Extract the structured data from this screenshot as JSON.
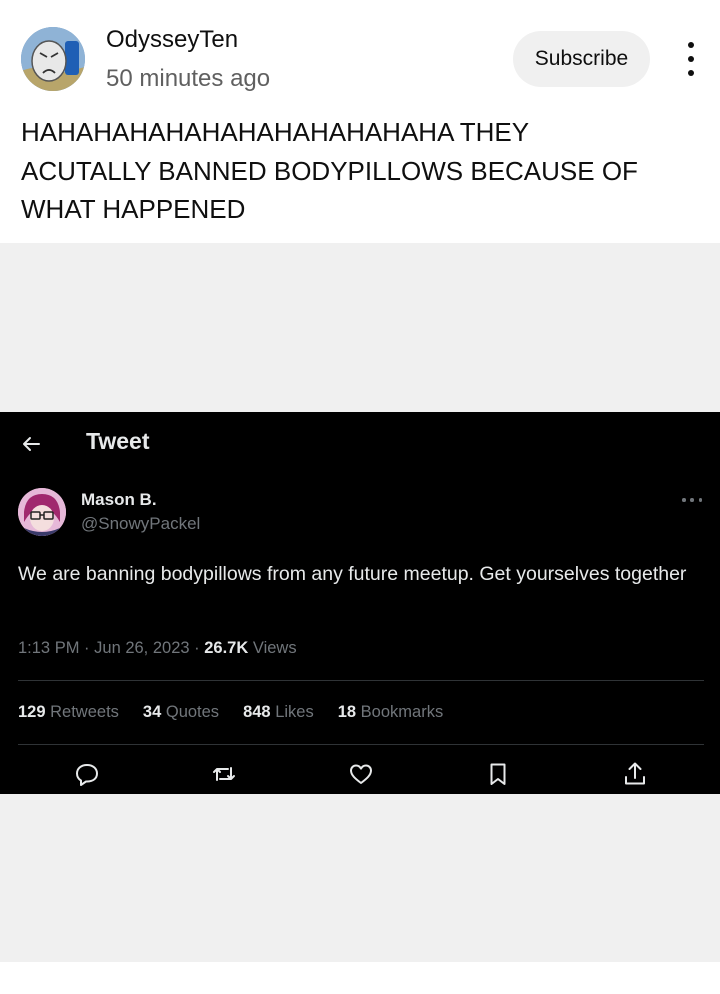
{
  "post": {
    "author": "OdysseyTen",
    "time": "50 minutes ago",
    "subscribe_label": "Subscribe",
    "text": "HAHAHAHAHAHAHAHAHAHAHAHA THEY\nACUTALLY BANNED BODYPILLOWS BECAUSE OF\nWHAT HAPPENED"
  },
  "tweet": {
    "header_title": "Tweet",
    "author_name": "Mason B.",
    "author_handle": "@SnowyPackel",
    "body": "We are banning bodypillows from any future meetup. Get yourselves together",
    "time": "1:13 PM",
    "date": "Jun 26, 2023",
    "views_count": "26.7K",
    "views_label": "Views",
    "stats": {
      "retweets_count": "129",
      "retweets_label": "Retweets",
      "quotes_count": "34",
      "quotes_label": "Quotes",
      "likes_count": "848",
      "likes_label": "Likes",
      "bookmarks_count": "18",
      "bookmarks_label": "Bookmarks"
    },
    "actions": [
      "reply-icon",
      "retweet-icon",
      "like-icon",
      "bookmark-icon",
      "share-icon"
    ]
  },
  "colors": {
    "background": "#ffffff",
    "media_background": "#f0f0f0",
    "subscribe_bg": "#f0f0f0",
    "secondary_text": "#606060",
    "tweet_background": "#000000",
    "tweet_text": "#e7e9ea",
    "tweet_muted": "#71767b",
    "tweet_divider": "#2f3336"
  }
}
